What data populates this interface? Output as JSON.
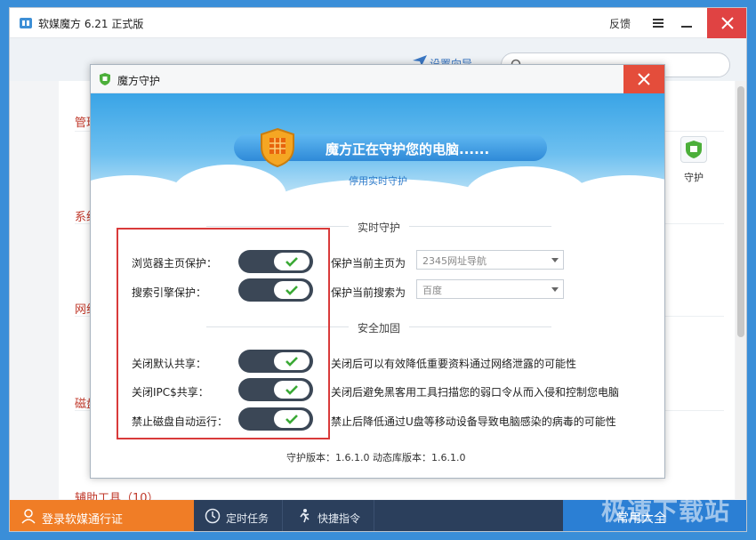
{
  "app": {
    "title": "软媒魔方 6.21 正式版",
    "feedback": "反馈",
    "wizard": "设置向导",
    "sections": [
      {
        "label": "管理"
      },
      {
        "label": "系统"
      },
      {
        "label": "网络"
      },
      {
        "label": "磁盘"
      },
      {
        "label": "辅助工具（10）"
      }
    ],
    "guard_label": "守护",
    "bottom": {
      "login": "登录软媒通行证",
      "scheduled": "定时任务",
      "shortcut": "快捷指令",
      "common": "常用大全"
    },
    "watermark": "极速下载站"
  },
  "dialog": {
    "title": "魔方守护",
    "hero_text": "魔方正在守护您的电脑......",
    "disable_link": "停用实时守护",
    "realtime_group": "实时守护",
    "security_group": "安全加固",
    "rows": [
      {
        "label": "浏览器主页保护：",
        "state": "on",
        "desc": "保护当前主页为",
        "select": "2345网址导航"
      },
      {
        "label": "搜索引擎保护：",
        "state": "on",
        "desc": "保护当前搜索为",
        "select": "百度"
      },
      {
        "label": "关闭默认共享：",
        "state": "on",
        "desc": "关闭后可以有效降低重要资料通过网络泄露的可能性"
      },
      {
        "label": "关闭IPC$共享：",
        "state": "on",
        "desc": "关闭后避免黑客用工具扫描您的弱口令从而入侵和控制您电脑"
      },
      {
        "label": "禁止磁盘自动运行：",
        "state": "on",
        "desc": "禁止后降低通过U盘等移动设备导致电脑感染的病毒的可能性"
      }
    ],
    "version": "守护版本：1.6.1.0    动态库版本：1.6.1.0"
  },
  "colors": {
    "accent": "#2b7fd4",
    "close": "#e44d3b",
    "login": "#f07d26",
    "toggle_track": "#3b4756",
    "check": "#3aa935",
    "highlight": "#d93a3a"
  }
}
